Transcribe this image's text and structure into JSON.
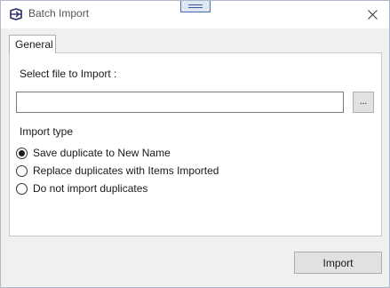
{
  "window": {
    "title": "Batch Import",
    "close_glyph": "✕"
  },
  "tabs": [
    {
      "label": "General",
      "selected": true
    }
  ],
  "file": {
    "label": "Select file to Import :",
    "value": "",
    "placeholder": "",
    "browse_label": "..."
  },
  "import_type": {
    "label": "Import type",
    "options": [
      {
        "label": "Save duplicate to New Name",
        "selected": true
      },
      {
        "label": "Replace duplicates with Items Imported",
        "selected": false
      },
      {
        "label": "Do not import duplicates",
        "selected": false
      }
    ]
  },
  "actions": {
    "import_label": "Import"
  },
  "icons": {
    "app": "batch-import-app-icon",
    "close": "close-icon",
    "grip": "drag-handle-icon"
  },
  "colors": {
    "app_icon": "#2b2b6b",
    "accent_border": "#4b6db0"
  }
}
